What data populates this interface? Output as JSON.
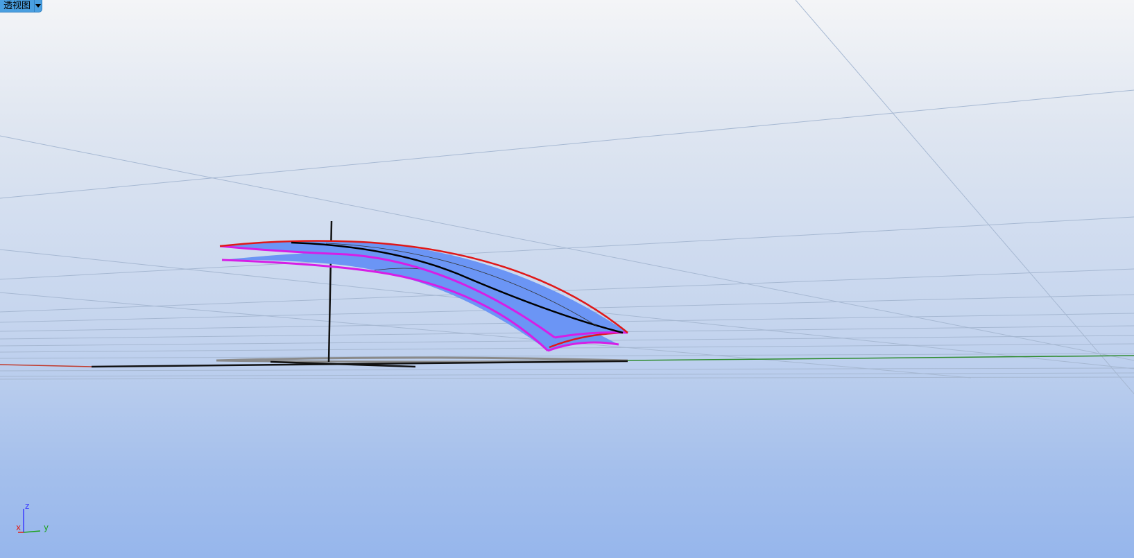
{
  "viewport": {
    "name": "透视图",
    "menu_icon": "chevron-down-icon"
  },
  "axis_widget": {
    "x_label": "x",
    "y_label": "y",
    "z_label": "z"
  },
  "colors": {
    "surface_fill": "#6b95f5",
    "edge_magenta": "#d61ee6",
    "edge_red": "#e01818",
    "world_x_axis": "#c0392b",
    "world_y_axis": "#2e8b2e",
    "grid_line": "#9fb2cc"
  }
}
